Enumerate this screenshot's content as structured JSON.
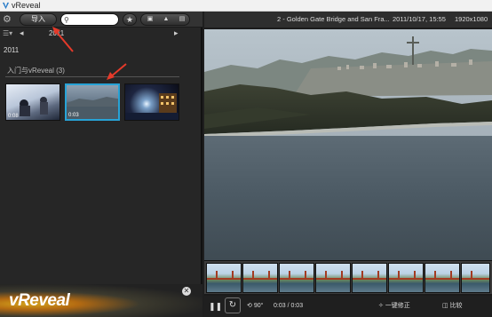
{
  "window": {
    "title": "vReveal"
  },
  "toolbar": {
    "import_label": "导入",
    "search_placeholder": "",
    "star_label": "★"
  },
  "nav": {
    "year": "2011"
  },
  "library": {
    "year_heading": "2011",
    "group_title": "入门与vReveal (3)",
    "thumbnails": [
      {
        "duration": "0:08"
      },
      {
        "duration": "0:03"
      },
      {
        "duration": ""
      }
    ]
  },
  "brand": {
    "logo": "vReveal"
  },
  "info": {
    "name": "2 - Golden Gate Bridge and San Fra...",
    "date": "2011/10/17, 15:55",
    "resolution": "1920x1080"
  },
  "controls": {
    "rotate_label": "90°",
    "time": "0:03 / 0:03",
    "fix_label": "一键修正",
    "compare_label": "比较"
  },
  "icons": {
    "gear": "gear-icon",
    "search": "search-icon",
    "star": "star-icon",
    "pause": "pause-icon",
    "loop": "loop-icon",
    "rotate": "rotate-icon",
    "fix": "magic-wand-icon",
    "compare": "compare-icon",
    "close": "close-icon"
  },
  "colors": {
    "selection": "#27a3d6",
    "annotation_arrow": "#e53a2a"
  }
}
